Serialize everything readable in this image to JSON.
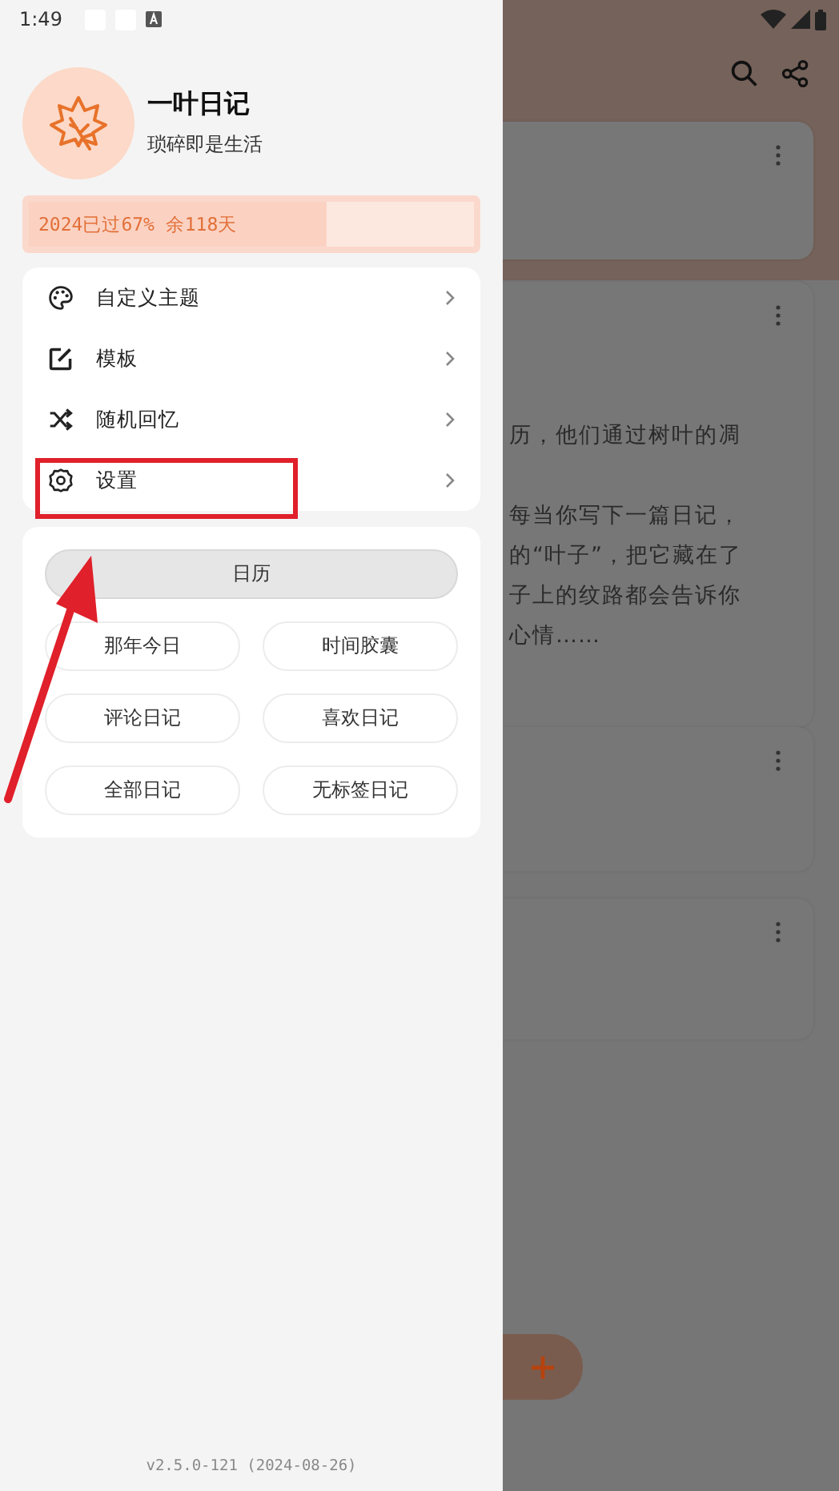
{
  "status_bar": {
    "time": "1:49"
  },
  "drawer": {
    "app_name": "一叶日记",
    "slogan": "琐碎即是生活",
    "year_progress": {
      "label": "2024已过67% 余118天",
      "level": 0.67
    },
    "menu": [
      {
        "label": "自定义主题"
      },
      {
        "label": "模板"
      },
      {
        "label": "随机回忆"
      },
      {
        "label": "设置"
      }
    ],
    "shortcuts": [
      {
        "label": "日历",
        "selected": true
      },
      {
        "label": "那年今日",
        "selected": false
      },
      {
        "label": "时间胶囊",
        "selected": false
      },
      {
        "label": "评论日记",
        "selected": false
      },
      {
        "label": "喜欢日记",
        "selected": false
      },
      {
        "label": "全部日记",
        "selected": false
      },
      {
        "label": "无标签日记",
        "selected": false
      }
    ],
    "version": "v2.5.0-121 (2024-08-26)"
  },
  "background_screen": {
    "entries": [
      {
        "kind": "blank"
      },
      {
        "kind": "text",
        "paragraphs": [
          [
            "历，他们通过树叶的凋"
          ],
          [
            "每当你写下一篇日记，",
            "的“叶子”，把它藏在了",
            "子上的纹路都会告诉你",
            "心情……"
          ]
        ]
      },
      {
        "kind": "blank"
      },
      {
        "kind": "blank"
      }
    ]
  },
  "annotations": [
    {
      "kind": "box"
    },
    {
      "kind": "arrow"
    }
  ]
}
